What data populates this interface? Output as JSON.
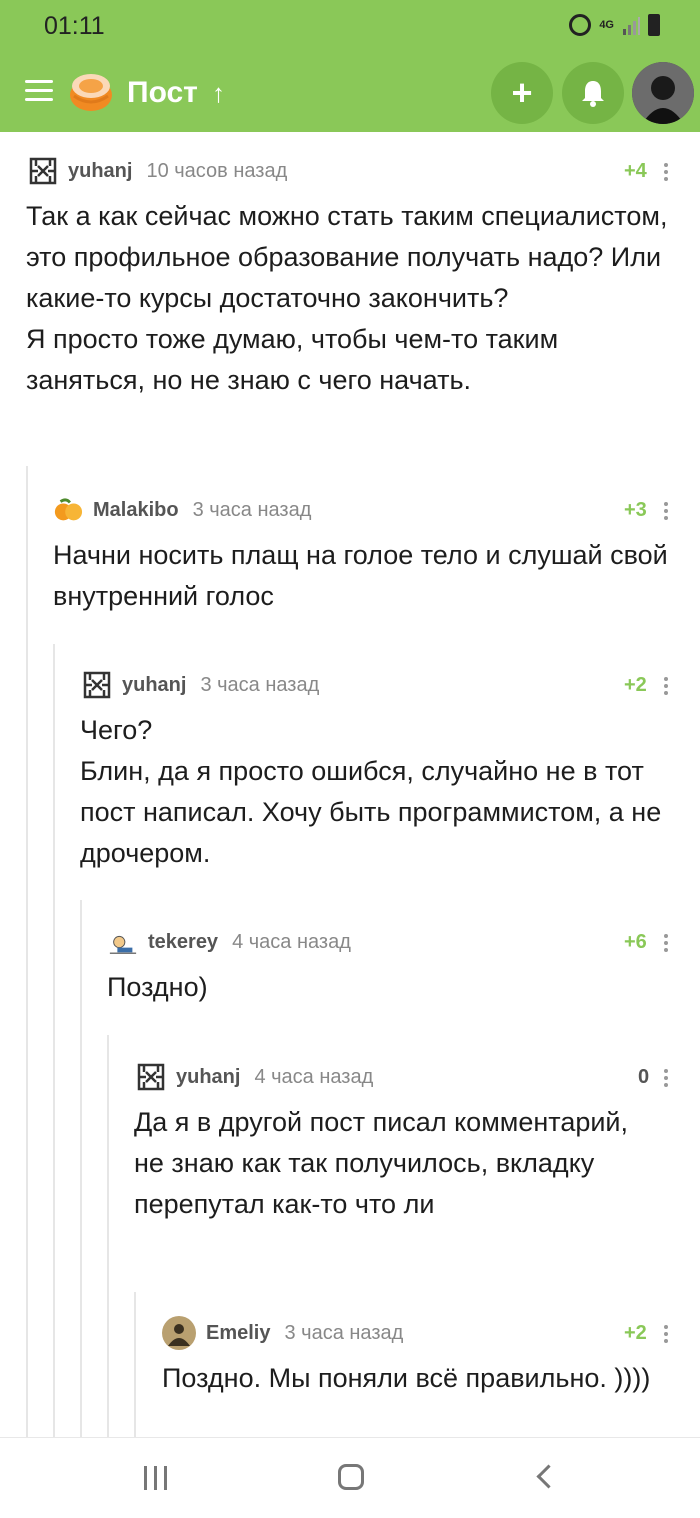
{
  "status": {
    "time": "01:11",
    "network": "4G"
  },
  "appbar": {
    "title": "Пост",
    "add_label": "+",
    "sort_arrow": "↑"
  },
  "icons": {
    "menu": "menu-icon",
    "logo": "pikabu-logo-icon",
    "add": "plus-icon",
    "bell": "bell-icon",
    "alarm": "alarm-icon",
    "signal": "signal-icon",
    "battery": "battery-icon",
    "more": "more-vertical-icon"
  },
  "colors": {
    "brand": "#8ac858",
    "brand_dark": "#75b445",
    "score_positive": "#8ac858"
  },
  "comments": [
    {
      "author": "yuhanj",
      "time": "10 часов назад",
      "score": "+4",
      "text": "Так а как сейчас можно стать таким специалистом, это профильное образование получать надо? Или какие-то курсы достаточно закончить?\nЯ просто тоже думаю, чтобы чем-то таким заняться, но не знаю с чего начать."
    },
    {
      "author": "Malakibo",
      "time": "3 часа назад",
      "score": "+3",
      "text": "Начни носить плащ на голое тело и слушай свой внутренний голос"
    },
    {
      "author": "yuhanj",
      "time": "3 часа назад",
      "score": "+2",
      "text": "Чего?\nБлин, да я просто ошибся, случайно не в тот пост написал. Хочу быть программистом, а не дрочером."
    },
    {
      "author": "tekerey",
      "time": "4 часа назад",
      "score": "+6",
      "text": "Поздно)"
    },
    {
      "author": "yuhanj",
      "time": "4 часа назад",
      "score": "0",
      "text": "Да я в другой пост писал комментарий, не знаю как так получилось, вкладку перепутал как-то что ли"
    },
    {
      "author": "Emeliy",
      "time": "3 часа назад",
      "score": "+2",
      "text": "Поздно. Мы поняли всё  правильно. ))))"
    }
  ],
  "navbar": {
    "recent": "recent-apps-icon",
    "home": "home-icon",
    "back": "back-icon"
  }
}
